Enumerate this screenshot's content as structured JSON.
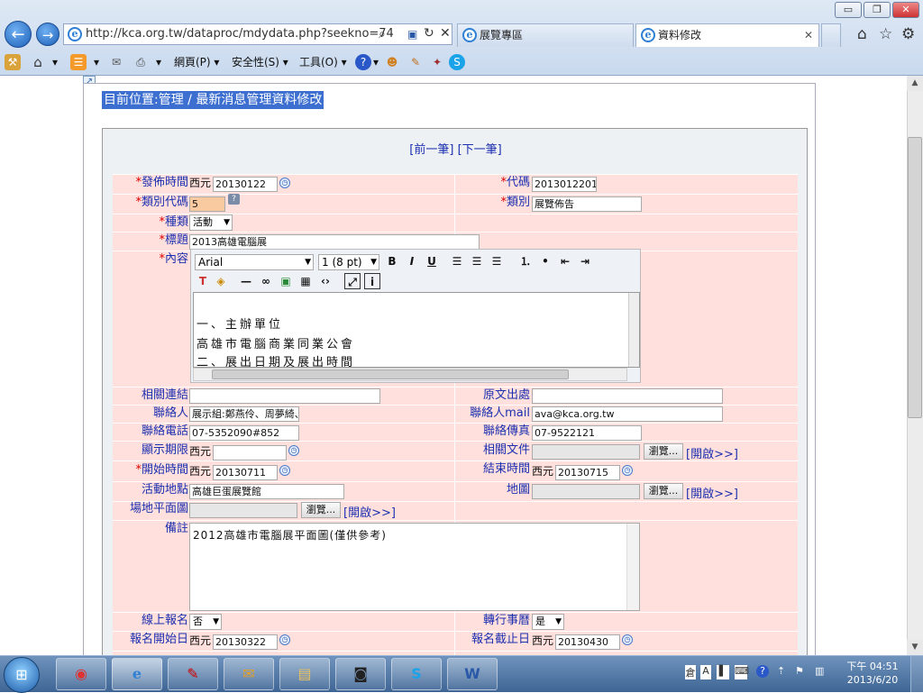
{
  "window": {
    "minimize_label": "▭",
    "restore_label": "❐",
    "close_label": "✕"
  },
  "browser": {
    "address": "http://kca.org.tw/dataproc/mdydata.php?seekno=74",
    "tabs": [
      {
        "label": "展覽專區"
      },
      {
        "label": "資料修改"
      }
    ],
    "menu": {
      "page": "網頁(P)",
      "safety": "安全性(S)",
      "tools": "工具(O)"
    }
  },
  "page": {
    "breadcrumb": "目前位置:管理 / 最新消息管理資料修改",
    "prev_label": "[前一筆]",
    "next_label": "[下一筆]",
    "labels": {
      "publish_time": "發佈時間",
      "code": "代碼",
      "category_code": "類別代碼",
      "category": "類別",
      "kind": "種類",
      "title": "標題",
      "content": "內容",
      "related_link": "相關連結",
      "source": "原文出處",
      "contact": "聯絡人",
      "contact_mail": "聯絡人mail",
      "contact_phone": "聯絡電話",
      "contact_fax": "聯絡傳真",
      "display_limit": "顯示期限",
      "related_doc": "相關文件",
      "start_time": "開始時間",
      "end_time": "結束時間",
      "venue": "活動地點",
      "map": "地圖",
      "floor_plan": "場地平面圖",
      "remarks": "備註",
      "online_signup": "線上報名",
      "calendar": "轉行事曆",
      "signup_start": "報名開始日",
      "signup_end": "報名截止日"
    },
    "era_prefix": "西元",
    "browse_label": "瀏覽...",
    "open_label": "[開啟>>]",
    "values": {
      "publish_time": "20130122",
      "code": "2013012201",
      "category_code": "5",
      "category": "展覽佈告",
      "kind": "活動",
      "title": "2013高雄電腦展",
      "related_link": "",
      "source": "",
      "contact": "展示組:鄭燕伶、周夢綺、",
      "contact_mail": "ava@kca.org.tw",
      "contact_phone": "07-5352090#852",
      "contact_fax": "07-9522121",
      "display_limit": "",
      "start_time": "20130711",
      "end_time": "20130715",
      "venue": "高雄巨蛋展覽館",
      "remarks": "2012高雄市電腦展平面圖(僅供參考)",
      "online_signup": "否",
      "calendar": "是",
      "signup_start": "20130322",
      "signup_end": "20130430"
    },
    "editor": {
      "font": "Arial",
      "size": "1 (8 pt)",
      "lines": [
        "一、主辦單位",
        "高雄市電腦商業同業公會",
        "二、展出日期及展出時間"
      ]
    }
  },
  "taskbar": {
    "time": "下午 04:51",
    "date": "2013/6/20"
  }
}
